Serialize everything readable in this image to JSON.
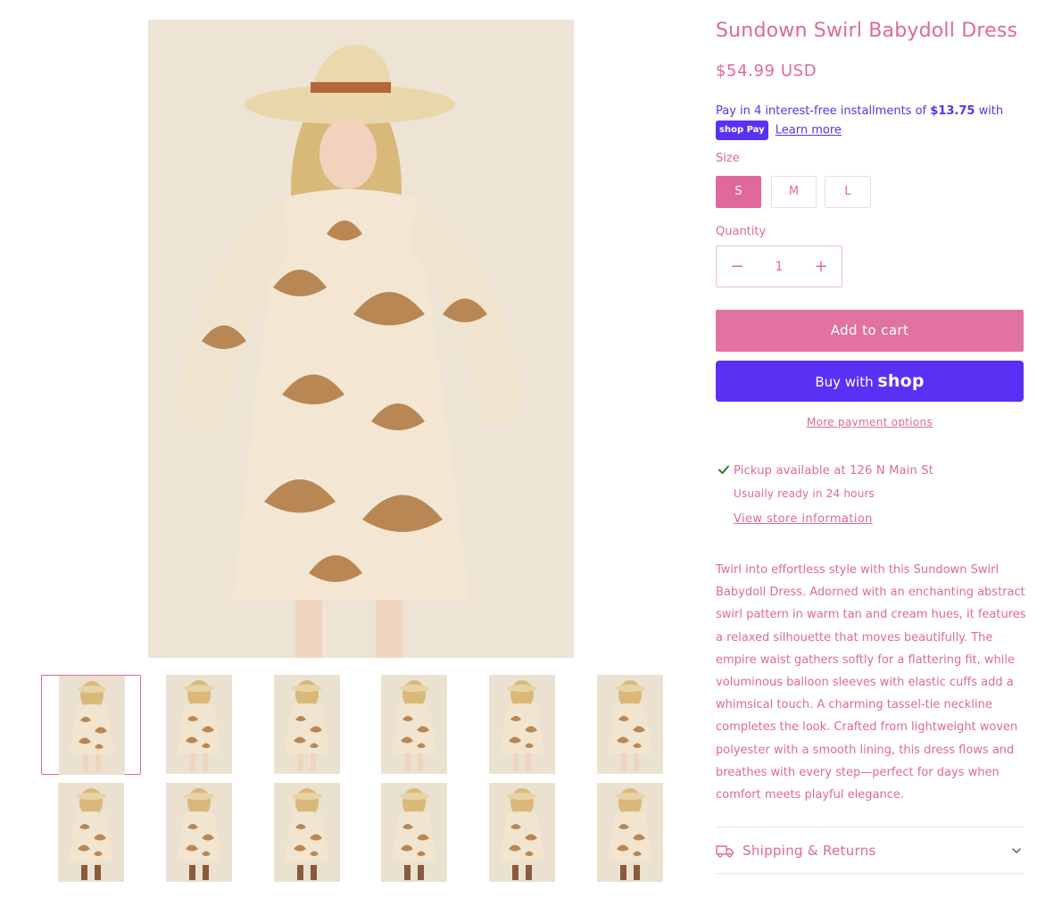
{
  "product": {
    "title": "Sundown Swirl Babydoll Dress",
    "price": "$54.99 USD"
  },
  "installments": {
    "prefix": "Pay in 4 interest-free installments of",
    "amount": "$13.75",
    "suffix": "with",
    "badge": "shop Pay",
    "learn_more": "Learn more"
  },
  "size": {
    "label": "Size",
    "options": [
      "S",
      "M",
      "L"
    ],
    "selected": "S"
  },
  "quantity": {
    "label": "Quantity",
    "value": "1",
    "decrease": "−",
    "increase": "+"
  },
  "buttons": {
    "add_to_cart": "Add to cart",
    "buy_with": "Buy with",
    "buy_with_brand": "shop",
    "more_payment": "More payment options"
  },
  "pickup": {
    "line": "Pickup available at 126 N Main St",
    "ready": "Usually ready in 24 hours",
    "store_link": "View store information"
  },
  "description": "Twirl into effortless style with this Sundown Swirl Babydoll Dress. Adorned with an enchanting abstract swirl pattern in warm tan and cream hues, it features a relaxed silhouette that moves beautifully. The empire waist gathers softly for a flattering fit, while voluminous balloon sleeves with elastic cuffs add a whimsical touch. A charming tassel-tie neckline completes the look. Crafted from lightweight woven polyester with a smooth lining, this dress flows and breathes with every step—perfect for days when comfort meets playful elegance.",
  "accordion": {
    "shipping_label": "Shipping & Returns"
  },
  "gallery": {
    "thumbnail_count": 12,
    "active_index": 0
  },
  "colors": {
    "accent": "#e0689b",
    "button": "#e2729f",
    "shop_pay": "#5a31f4",
    "check": "#2e7d32"
  }
}
